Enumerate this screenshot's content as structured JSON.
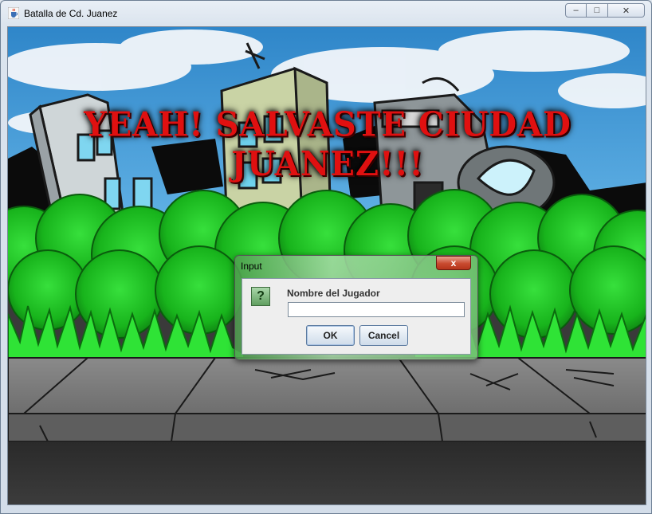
{
  "window": {
    "title": "Batalla de Cd. Juanez",
    "app_icon": "java-cup-icon",
    "controls": {
      "minimize": "–",
      "maximize": "□",
      "close": "✕"
    }
  },
  "scene": {
    "banner_text": "YEAH! SALVASTE CIUDAD JUANEZ!!!",
    "banner_color": "#e01010"
  },
  "dialog": {
    "title": "Input",
    "close_symbol": "x",
    "icon": "question-icon",
    "icon_glyph": "?",
    "prompt_label": "Nombre del Jugador",
    "input_value": "",
    "ok_label": "OK",
    "cancel_label": "Cancel"
  }
}
